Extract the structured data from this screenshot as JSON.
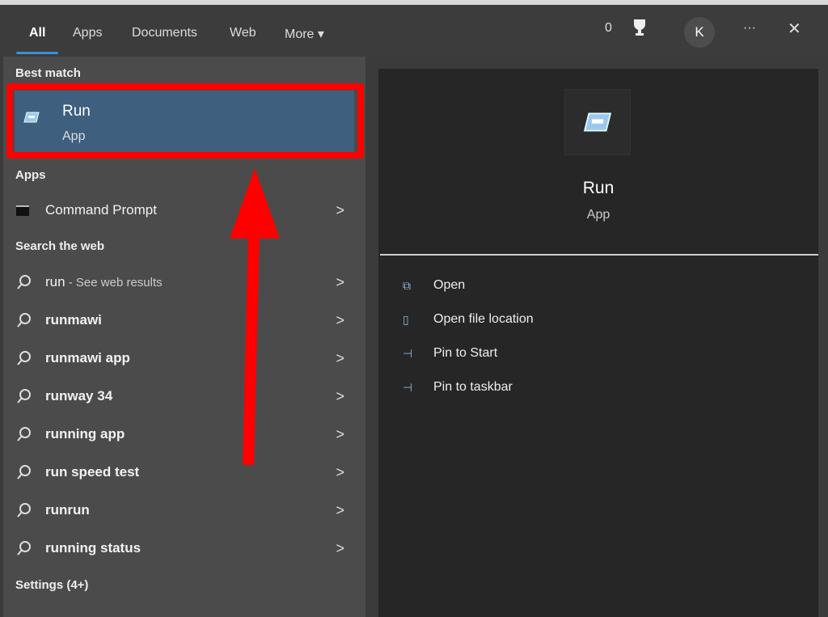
{
  "tabs": [
    {
      "label": "All",
      "active": true
    },
    {
      "label": "Apps"
    },
    {
      "label": "Documents"
    },
    {
      "label": "Web"
    },
    {
      "label": "More ▾"
    }
  ],
  "header": {
    "points": "0",
    "avatar_initial": "K",
    "more": "···",
    "close": "✕"
  },
  "left": {
    "best_match_label": "Best match",
    "best_match": {
      "title": "Run",
      "subtitle": "App"
    },
    "apps_label": "Apps",
    "apps": [
      {
        "label": "Command Prompt"
      }
    ],
    "web_label": "Search the web",
    "web": [
      {
        "label": "run",
        "suffix": " - See web results"
      },
      {
        "label": "runmawi"
      },
      {
        "label": "runmawi app"
      },
      {
        "label": "runway 34"
      },
      {
        "label": "running app"
      },
      {
        "label": "run speed test"
      },
      {
        "label": "runrun"
      },
      {
        "label": "running status"
      }
    ],
    "settings_label": "Settings (4+)"
  },
  "detail": {
    "title": "Run",
    "subtitle": "App",
    "actions": [
      {
        "label": "Open",
        "icon": "open-icon"
      },
      {
        "label": "Open file location",
        "icon": "folder-icon"
      },
      {
        "label": "Pin to Start",
        "icon": "pin-icon"
      },
      {
        "label": "Pin to taskbar",
        "icon": "pin-icon"
      }
    ]
  },
  "colors": {
    "accent": "#3a8fd8",
    "selection": "#3e5f7e",
    "highlight": "#ff0000"
  }
}
